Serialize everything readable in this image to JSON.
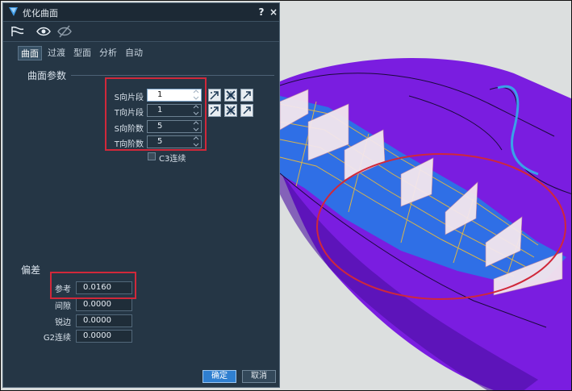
{
  "window": {
    "title": "优化曲面",
    "help": "?",
    "close": "×"
  },
  "tabs": [
    {
      "label": "曲面",
      "active": true
    },
    {
      "label": "过渡",
      "active": false
    },
    {
      "label": "型面",
      "active": false
    },
    {
      "label": "分析",
      "active": false
    },
    {
      "label": "自动",
      "active": false
    }
  ],
  "surface_params": {
    "title": "曲面参数",
    "rows": [
      {
        "label": "S向片段",
        "value": "1"
      },
      {
        "label": "T向片段",
        "value": "1"
      },
      {
        "label": "S向阶数",
        "value": "5"
      },
      {
        "label": "T向阶数",
        "value": "5"
      }
    ],
    "c3_label": "C3连续"
  },
  "deviation": {
    "title": "偏差",
    "rows": [
      {
        "label": "参考",
        "value": "0.0160"
      },
      {
        "label": "间隙",
        "value": "0.0000"
      },
      {
        "label": "锐边",
        "value": "0.0000"
      },
      {
        "label": "G2连续",
        "value": "0.0000"
      }
    ]
  },
  "buttons": {
    "ok": "确定",
    "cancel": "取消"
  },
  "colors": {
    "dialog_bg": "#253645",
    "accent": "#2f7fd0",
    "highlight": "#d0283a",
    "surface": "#7d1fe0",
    "patch": "#2f6fe6"
  }
}
